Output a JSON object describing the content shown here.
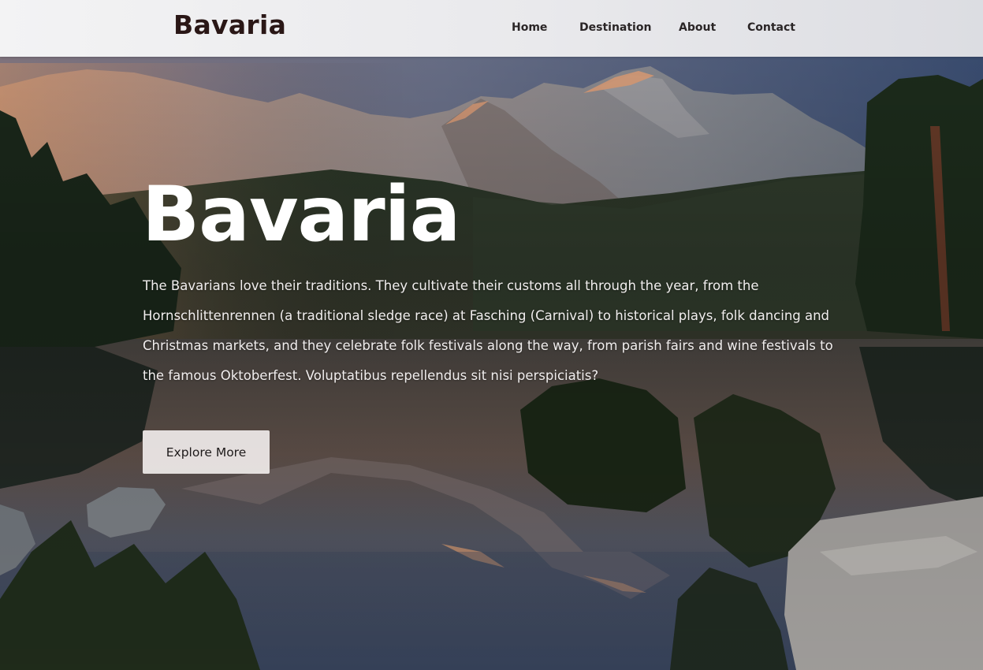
{
  "header": {
    "logo": "Bavaria",
    "nav": {
      "home": "Home",
      "destination": "Destination",
      "about": "About",
      "contact": "Contact"
    }
  },
  "hero": {
    "title": "Bavaria",
    "description": "The Bavarians love their traditions. They cultivate their customs all through the year, from the Hornschlittenrennen (a traditional sledge race) at Fasching (Carnival) to historical plays, folk dancing and Christmas markets, and they celebrate folk festivals along the way, from parish fairs and wine festivals to the famous Oktoberfest. Voluptatibus repellendus sit nisi perspiciatis?",
    "button_label": "Explore More"
  },
  "colors": {
    "header_bg": "#ececee",
    "logo_text": "#2a1716",
    "nav_text": "#2a2526",
    "hero_title": "#ffffff",
    "button_bg": "#f0ecea"
  }
}
